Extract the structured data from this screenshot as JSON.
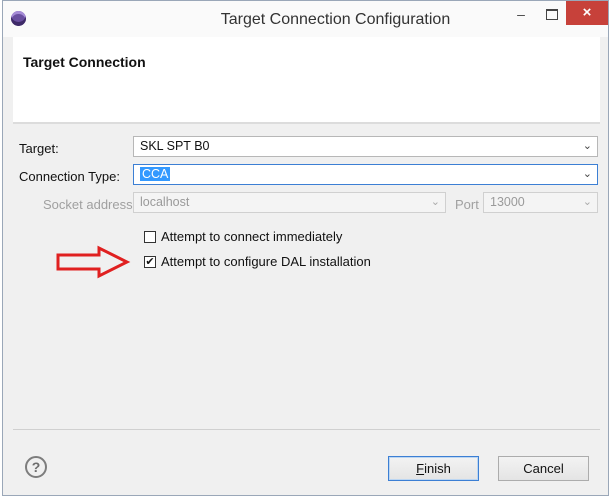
{
  "window": {
    "title": "Target Connection Configuration",
    "close_glyph": "×",
    "minimize_glyph": "–"
  },
  "banner": {
    "title": "Target Connection"
  },
  "form": {
    "target": {
      "label": "Target:",
      "value": "SKL SPT B0"
    },
    "connection_type": {
      "label": "Connection Type:",
      "value": "CCA"
    },
    "socket_address": {
      "label": "Socket address:",
      "value": "localhost"
    },
    "port": {
      "label": "Port",
      "value": "13000"
    },
    "connect_immediately": {
      "label": "Attempt to connect immediately",
      "checked": false
    },
    "configure_dal": {
      "label": "Attempt to configure DAL installation",
      "checked": true,
      "mark": "✔"
    }
  },
  "footer": {
    "help_glyph": "?",
    "finish_first": "F",
    "finish_rest": "inish",
    "cancel_label": "Cancel"
  },
  "colors": {
    "accent": "#3399ff",
    "close": "#c7413a",
    "annotation_arrow": "#e02020"
  }
}
